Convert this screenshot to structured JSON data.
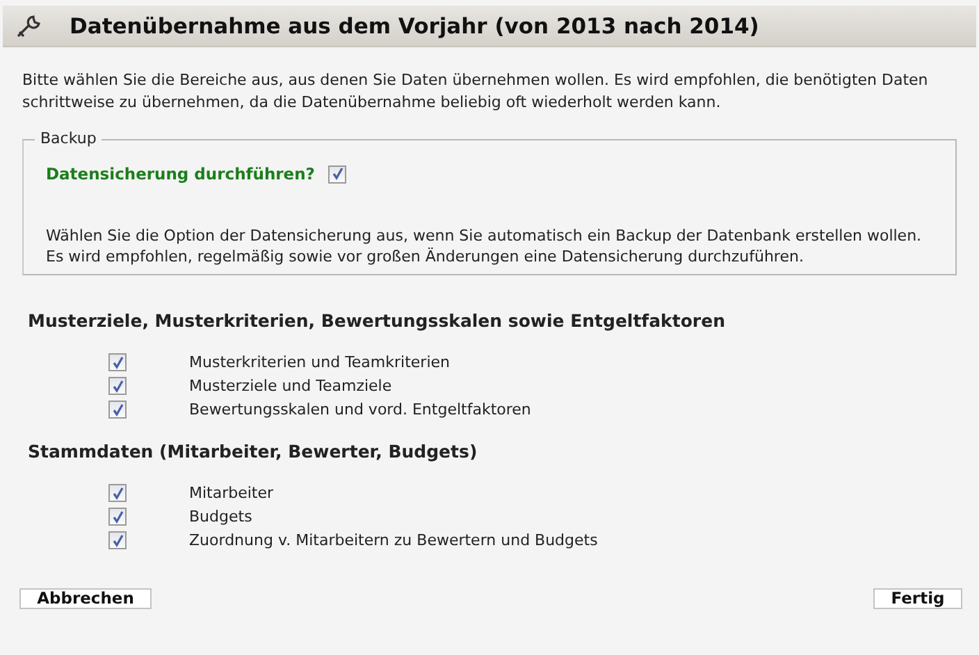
{
  "header": {
    "title": "Datenübernahme aus dem Vorjahr (von 2013 nach 2014)"
  },
  "intro": "Bitte wählen Sie die Bereiche aus, aus denen Sie Daten übernehmen wollen. Es wird empfohlen, die benötigten Daten schrittweise zu übernehmen, da die Datenübernahme beliebig oft wiederholt werden kann.",
  "backup": {
    "legend": "Backup",
    "option": {
      "label": "Datensicherung durchführen?",
      "checked": true
    },
    "note": "Wählen Sie die Option der Datensicherung aus, wenn Sie automatisch ein Backup der Datenbank erstellen wollen. Es wird empfohlen, regelmäßig sowie vor großen Änderungen eine Datensicherung durchzuführen."
  },
  "sections": [
    {
      "heading": "Musterziele, Musterkriterien, Bewertungsskalen sowie Entgeltfaktoren",
      "items": [
        {
          "label": "Musterkriterien und Teamkriterien",
          "checked": true
        },
        {
          "label": "Musterziele und Teamziele",
          "checked": true
        },
        {
          "label": "Bewertungsskalen und vord. Entgeltfaktoren",
          "checked": true
        }
      ]
    },
    {
      "heading": "Stammdaten (Mitarbeiter, Bewerter, Budgets)",
      "items": [
        {
          "label": "Mitarbeiter",
          "checked": true
        },
        {
          "label": "Budgets",
          "checked": true
        },
        {
          "label": "Zuordnung v. Mitarbeitern zu Bewertern und Budgets",
          "checked": true
        }
      ]
    }
  ],
  "buttons": {
    "cancel": "Abbrechen",
    "finish": "Fertig"
  }
}
